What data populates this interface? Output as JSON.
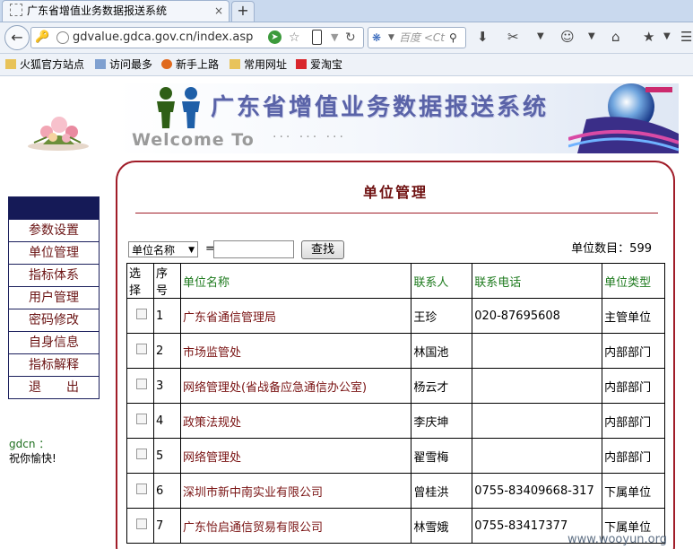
{
  "browser": {
    "tab_title": "广东省增值业务数据报送系统",
    "tab_close": "×",
    "new_tab": "+",
    "url": "gdvalue.gdca.gov.cn/index.asp",
    "search_placeholder": "百度 <Ct",
    "bookmarks": [
      "火狐官方站点",
      "访问最多",
      "新手上路",
      "常用网址",
      "爱淘宝"
    ]
  },
  "banner": {
    "title": "广东省增值业务数据报送系统",
    "welcome": "Welcome To",
    "dots": "··· ··· ···"
  },
  "sidebar": {
    "items": [
      "参数设置",
      "单位管理",
      "指标体系",
      "用户管理",
      "密码修改",
      "自身信息",
      "指标解释",
      "退　　出"
    ]
  },
  "greeting": {
    "user": "gdcn ：",
    "message": "祝你愉快!"
  },
  "panel": {
    "title": "单位管理",
    "filter_field": "单位名称",
    "equals": "=",
    "keyword_value": "",
    "find_label": "查找",
    "count_label": "单位数目：599"
  },
  "table": {
    "headers": [
      "选择",
      "序号",
      "单位名称",
      "联系人",
      "联系电话",
      "单位类型"
    ],
    "rows": [
      {
        "no": "1",
        "name": "广东省通信管理局",
        "contact": "王珍",
        "phone": "020-87695608",
        "type": "主管单位"
      },
      {
        "no": "2",
        "name": "市场监管处",
        "contact": "林国池",
        "phone": "",
        "type": "内部部门"
      },
      {
        "no": "3",
        "name": "网络管理处(省战备应急通信办公室)",
        "contact": "杨云才",
        "phone": "",
        "type": "内部部门"
      },
      {
        "no": "4",
        "name": "政策法规处",
        "contact": "李庆坤",
        "phone": "",
        "type": "内部部门"
      },
      {
        "no": "5",
        "name": "网络管理处",
        "contact": "翟雪梅",
        "phone": "",
        "type": "内部部门"
      },
      {
        "no": "6",
        "name": "深圳市新中南实业有限公司",
        "contact": "曾桂洪",
        "phone": "0755-83409668-317",
        "type": "下属单位"
      },
      {
        "no": "7",
        "name": "广东怡启通信贸易有限公司",
        "contact": "林雪娥",
        "phone": "0755-83417377",
        "type": "下属单位"
      }
    ]
  },
  "watermark": "www.wooyun.org"
}
